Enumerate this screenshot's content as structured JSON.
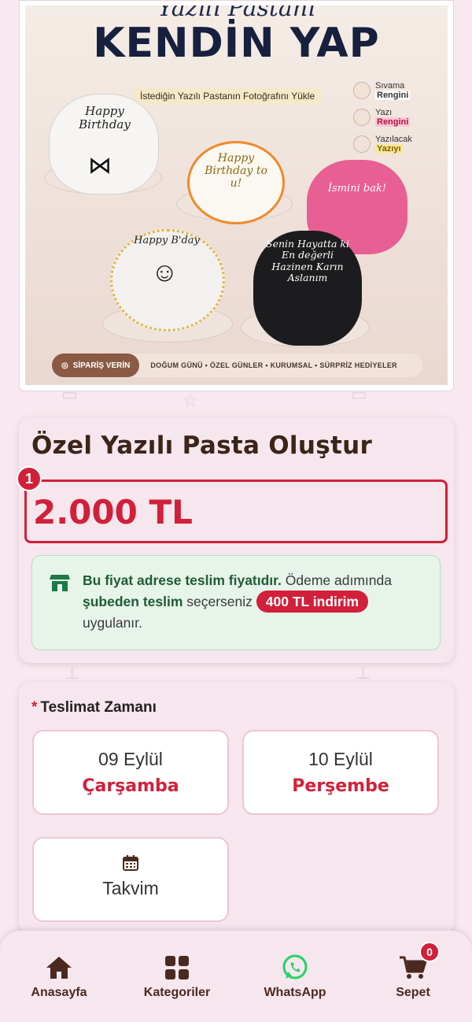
{
  "banner": {
    "script_title": "Yazılı Pastanı",
    "title": "KENDİN YAP",
    "subtitle": "İstediğin Yazılı Pastanın Fotoğrafını Yükle",
    "options": [
      {
        "line1": "Sıvama",
        "line2": "Rengini"
      },
      {
        "line1": "Yazı",
        "line2": "Rengini"
      },
      {
        "line1": "Yazılacak",
        "line2": "Yazıyı"
      }
    ],
    "cakes": [
      "Happy Birthday",
      "Happy Birthday to u!",
      "İsmini bak!",
      "Happy B'day",
      "Senin Hayatta ki En değerli Hazinen Karın Aslanım"
    ],
    "footer_cta": "SİPARİŞ VERİN",
    "footer_tags": "DOĞUM GÜNÜ • ÖZEL GÜNLER • KURUMSAL • SÜRPRİZ HEDİYELER"
  },
  "product": {
    "title": "Özel Yazılı Pasta Oluştur",
    "marker": "1",
    "price": "2.000 TL",
    "notice": {
      "bold1": "Bu fiyat adrese teslim fiyatıdır.",
      "text1": " Ödeme adımında ",
      "bold2": "şubeden teslim",
      "text2": " seçerseniz ",
      "pill": "400 TL indirim",
      "text3": "uygulanır."
    }
  },
  "delivery": {
    "title": "Teslimat Zamanı",
    "required_mark": "*",
    "options": [
      {
        "date": "09 Eylül",
        "weekday": "Çarşamba"
      },
      {
        "date": "10 Eylül",
        "weekday": "Perşembe"
      }
    ],
    "calendar_label": "Takvim"
  },
  "nav": {
    "items": [
      {
        "label": "Anasayfa",
        "icon": "home-icon"
      },
      {
        "label": "Kategoriler",
        "icon": "grid-icon"
      },
      {
        "label": "WhatsApp",
        "icon": "whatsapp-icon"
      },
      {
        "label": "Sepet",
        "icon": "cart-icon"
      }
    ],
    "cart_count": "0"
  },
  "colors": {
    "accent": "#d2203a",
    "background": "#f8e9f0",
    "notice_bg": "#e6f4ea",
    "whatsapp": "#25d366",
    "brown": "#4a2a20"
  }
}
